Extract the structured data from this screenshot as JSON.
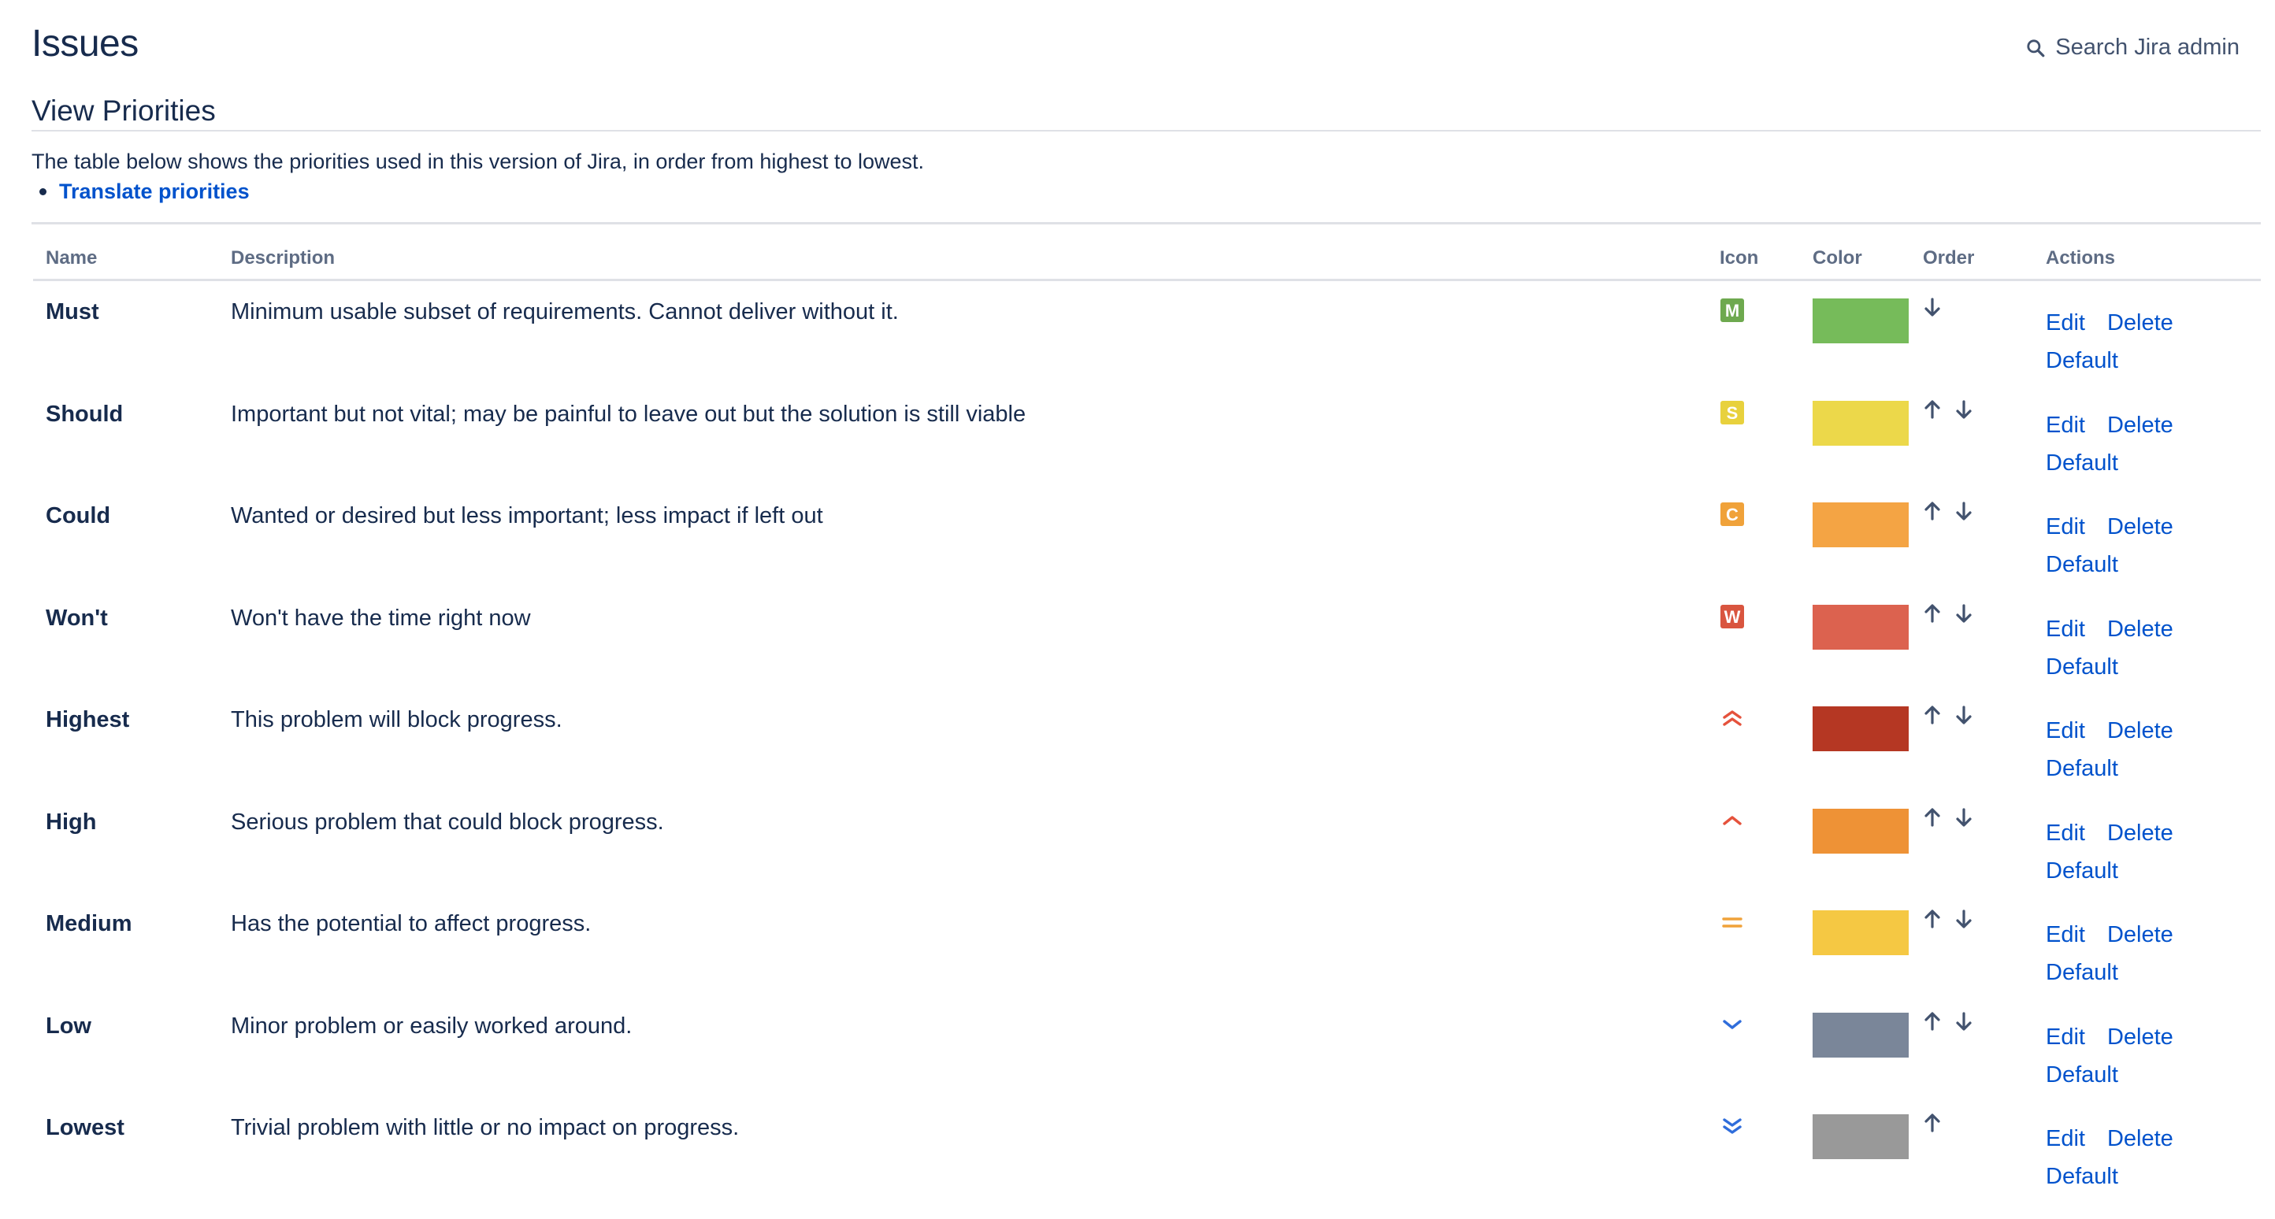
{
  "header": {
    "title": "Issues",
    "search_label": "Search Jira admin"
  },
  "section": {
    "title": "View Priorities",
    "intro": "The table below shows the priorities used in this version of Jira, in order from highest to lowest.",
    "translate_link": "Translate priorities"
  },
  "table": {
    "headers": {
      "name": "Name",
      "description": "Description",
      "icon": "Icon",
      "color": "Color",
      "order": "Order",
      "actions": "Actions"
    },
    "action_labels": {
      "edit": "Edit",
      "delete": "Delete",
      "default": "Default"
    },
    "rows": [
      {
        "name": "Must",
        "description": "Minimum usable subset of requirements. Cannot deliver without it.",
        "icon": "letter-m-icon",
        "color": "#76bb5a",
        "up": false,
        "down": true
      },
      {
        "name": "Should",
        "description": "Important but not vital; may be painful to leave out but the solution is still viable",
        "icon": "letter-s-icon",
        "color": "#ecd84a",
        "up": true,
        "down": true
      },
      {
        "name": "Could",
        "description": "Wanted or desired but less important; less impact if left out",
        "icon": "letter-c-icon",
        "color": "#f4a444",
        "up": true,
        "down": true
      },
      {
        "name": "Won't",
        "description": "Won't have the time right now",
        "icon": "letter-w-icon",
        "color": "#dc624f",
        "up": true,
        "down": true
      },
      {
        "name": "Highest",
        "description": "This problem will block progress.",
        "icon": "priority-highest-icon",
        "color": "#b53723",
        "up": true,
        "down": true
      },
      {
        "name": "High",
        "description": "Serious problem that could block progress.",
        "icon": "priority-high-icon",
        "color": "#ee9236",
        "up": true,
        "down": true
      },
      {
        "name": "Medium",
        "description": "Has the potential to affect progress.",
        "icon": "priority-medium-icon",
        "color": "#f5c843",
        "up": true,
        "down": true
      },
      {
        "name": "Low",
        "description": "Minor problem or easily worked around.",
        "icon": "priority-low-icon",
        "color": "#7a8699",
        "up": true,
        "down": true
      },
      {
        "name": "Lowest",
        "description": "Trivial problem with little or no impact on progress.",
        "icon": "priority-lowest-icon",
        "color": "#999999",
        "up": true,
        "down": false
      }
    ]
  }
}
